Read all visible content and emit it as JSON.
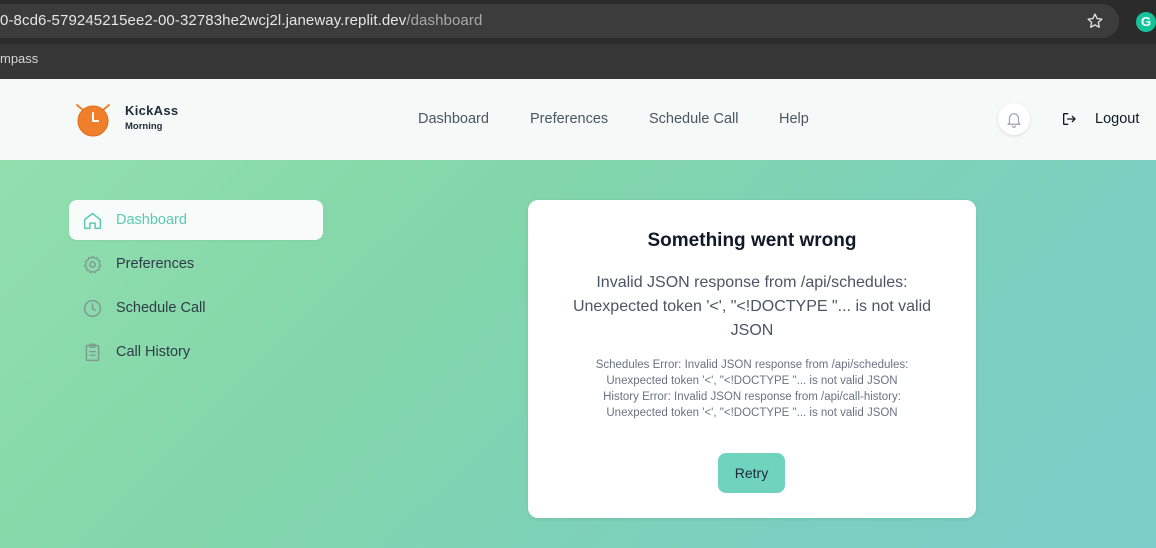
{
  "browser": {
    "url_host": "0-8cd6-579245215ee2-00-32783he2wcj2l.janeway.replit.dev",
    "url_path": "/dashboard",
    "bookmark": "mpass",
    "extension_letter": "G"
  },
  "header": {
    "logo_title": "KickAss",
    "logo_subtitle": "Morning",
    "nav": [
      "Dashboard",
      "Preferences",
      "Schedule Call",
      "Help"
    ],
    "logout": "Logout"
  },
  "sidebar": {
    "items": [
      {
        "label": "Dashboard",
        "icon": "home-icon",
        "active": true
      },
      {
        "label": "Preferences",
        "icon": "gear-icon",
        "active": false
      },
      {
        "label": "Schedule Call",
        "icon": "clock-icon",
        "active": false
      },
      {
        "label": "Call History",
        "icon": "clipboard-icon",
        "active": false
      }
    ]
  },
  "error_card": {
    "title": "Something went wrong",
    "message": "Invalid JSON response from /api/schedules: Unexpected token '<', \"<!DOCTYPE \"... is not valid JSON",
    "details": [
      "Schedules Error: Invalid JSON response from /api/schedules:",
      "Unexpected token '<', \"<!DOCTYPE \"... is not valid JSON",
      "History Error: Invalid JSON response from /api/call-history:",
      "Unexpected token '<', \"<!DOCTYPE \"... is not valid JSON"
    ],
    "retry": "Retry"
  },
  "colors": {
    "accent": "#6fd3bd",
    "active_text": "#5cc9b1",
    "logo_orange": "#f07f2c"
  }
}
